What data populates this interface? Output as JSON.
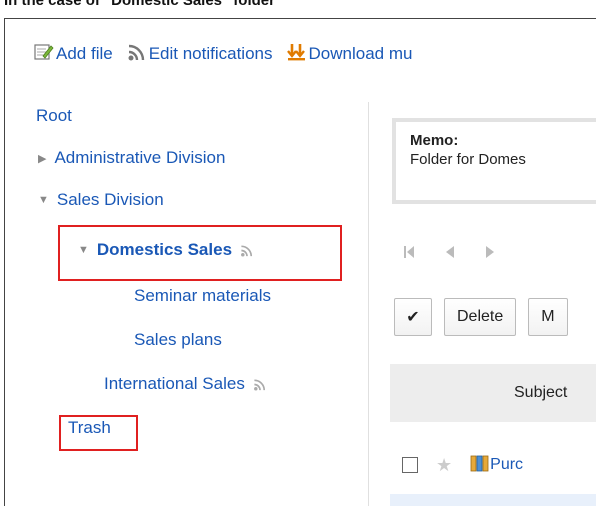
{
  "caption": "In the case of \"Domestic Sales\" folder",
  "toolbar": {
    "add_file": "Add file",
    "edit_notifications": "Edit notifications",
    "download": "Download mu"
  },
  "tree": {
    "root": "Root",
    "administrative": "Administrative Division",
    "sales": "Sales Division",
    "domestics": "Domestics Sales",
    "seminar": "Seminar materials",
    "plans": "Sales plans",
    "international": "International Sales",
    "trash": "Trash"
  },
  "memo": {
    "title": "Memo:",
    "text": "Folder for Domes"
  },
  "actions": {
    "check": "✔",
    "delete": "Delete",
    "move": "M"
  },
  "table": {
    "subject_header": "Subject",
    "row1_subject": "Purc"
  },
  "colors": {
    "link": "#1a58b6",
    "highlight": "#e02020",
    "header_bg": "#ededed"
  }
}
